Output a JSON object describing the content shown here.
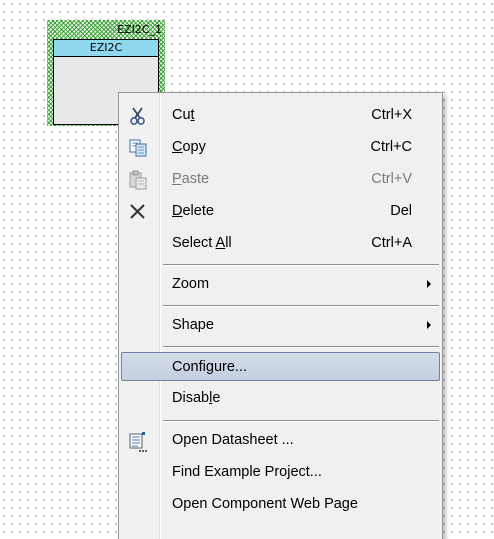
{
  "component": {
    "instance_name": "EZI2C_1",
    "title": "EZI2C"
  },
  "context_menu": {
    "items": [
      {
        "label": "Cut",
        "mnemonic_index": 2,
        "shortcut": "Ctrl+X",
        "enabled": true,
        "icon": "scissors-icon"
      },
      {
        "label": "Copy",
        "mnemonic_index": 0,
        "shortcut": "Ctrl+C",
        "enabled": true,
        "icon": "copy-icon"
      },
      {
        "label": "Paste",
        "mnemonic_index": 0,
        "shortcut": "Ctrl+V",
        "enabled": false,
        "icon": "paste-icon"
      },
      {
        "label": "Delete",
        "mnemonic_index": 0,
        "shortcut": "Del",
        "enabled": true,
        "icon": "delete-x-icon"
      },
      {
        "label": "Select All",
        "mnemonic_index": 7,
        "shortcut": "Ctrl+A",
        "enabled": true
      },
      {
        "label": "Zoom",
        "submenu": true,
        "enabled": true
      },
      {
        "label": "Shape",
        "submenu": true,
        "enabled": true
      },
      {
        "label": "Configure...",
        "mnemonic_index": 6,
        "enabled": true,
        "highlighted": true
      },
      {
        "label": "Disable",
        "mnemonic_index": 5,
        "enabled": true
      },
      {
        "label": "Open Datasheet ...",
        "enabled": true,
        "icon": "datasheet-icon"
      },
      {
        "label": "Find Example Project...",
        "enabled": true
      },
      {
        "label": "Open Component Web Page",
        "enabled": true
      }
    ]
  },
  "colors": {
    "highlight_border": "#6f82a6",
    "component_title_bg": "#8fd8ee",
    "hatch": "#2e962e"
  }
}
